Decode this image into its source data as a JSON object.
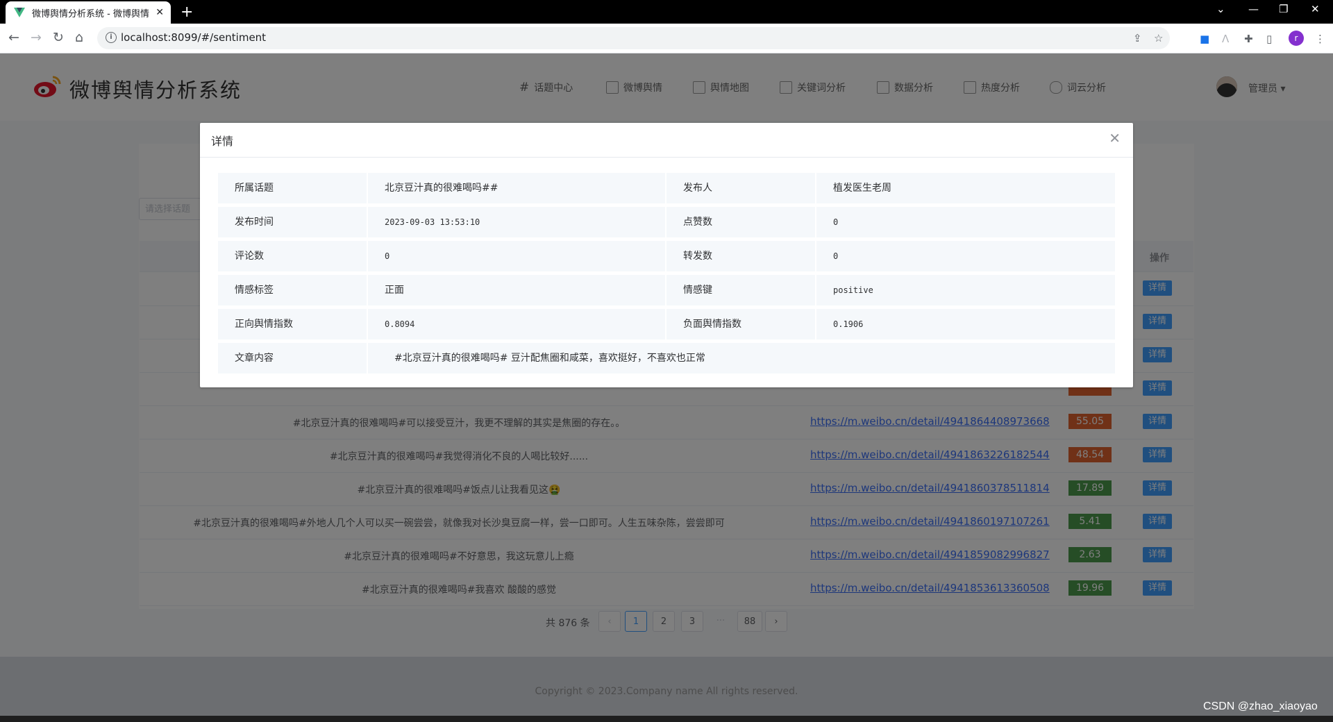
{
  "browser": {
    "tab_title": "微博舆情分析系统 - 微博舆情",
    "tab_close": "✕",
    "new_tab": "+",
    "url": "localhost:8099/#/sentiment",
    "profile_initial": "r"
  },
  "header": {
    "brand": "微博舆情分析系统",
    "nav": [
      "话题中心",
      "微博舆情",
      "舆情地图",
      "关键词分析",
      "数据分析",
      "热度分析",
      "词云分析"
    ],
    "user": "管理员 ▾"
  },
  "search": {
    "placeholder": "请选择话题"
  },
  "table": {
    "op_header": "操作",
    "detail_label": "详情",
    "rows": [
      {
        "content": "#北京豆汁真的很难喝吗#可以接受豆汁，我更不理解的其实是焦圈的存在。。",
        "link": "https://m.weibo.cn/detail/4941864408973668",
        "score": "55.05",
        "color": "#e0632f"
      },
      {
        "content": "#北京豆汁真的很难喝吗#我觉得消化不良的人喝比较好......",
        "link": "https://m.weibo.cn/detail/4941863226182544",
        "score": "48.54",
        "color": "#e0632f"
      },
      {
        "content": "#北京豆汁真的很难喝吗#饭点儿让我看见这🤮",
        "link": "https://m.weibo.cn/detail/4941860378511814",
        "score": "17.89",
        "color": "#4c9a4c"
      },
      {
        "content": "#北京豆汁真的很难喝吗#外地人几个人可以买一碗尝尝，就像我对长沙臭豆腐一样，尝一口即可。人生五味杂陈，尝尝即可",
        "link": "https://m.weibo.cn/detail/4941860197107261",
        "score": "5.41",
        "color": "#4c9a4c"
      },
      {
        "content": "#北京豆汁真的很难喝吗#不好意思，我这玩意儿上瘾",
        "link": "https://m.weibo.cn/detail/4941859082996827",
        "score": "2.63",
        "color": "#4c9a4c"
      },
      {
        "content": "#北京豆汁真的很难喝吗#我喜欢 酸酸的感觉",
        "link": "https://m.weibo.cn/detail/4941853613360508",
        "score": "19.96",
        "color": "#4c9a4c"
      }
    ]
  },
  "pagination": {
    "total": "共 876 条",
    "prev": "‹",
    "pages": [
      "1",
      "2",
      "3"
    ],
    "ellipsis": "···",
    "last": "88",
    "next": "›"
  },
  "footer": {
    "copyright": "Copyright © 2023.Company name All rights reserved."
  },
  "dialog": {
    "title": "详情",
    "close": "✕",
    "fields": [
      {
        "l1": "所属话题",
        "v1": "北京豆汁真的很难喝吗##",
        "l2": "发布人",
        "v2": "植发医生老周"
      },
      {
        "l1": "发布时间",
        "v1": "2023-09-03 13:53:10",
        "l2": "点赞数",
        "v2": "0"
      },
      {
        "l1": "评论数",
        "v1": "0",
        "l2": "转发数",
        "v2": "0"
      },
      {
        "l1": "情感标签",
        "v1": "正面",
        "l2": "情感键",
        "v2": "positive"
      },
      {
        "l1": "正向舆情指数",
        "v1": "0.8094",
        "l2": "负面舆情指数",
        "v2": "0.1906"
      }
    ],
    "content_label": "文章内容",
    "content_value": "#北京豆汁真的很难喝吗# 豆汁配焦圈和咸菜，喜欢挺好，不喜欢也正常"
  },
  "watermark": "CSDN @zhao_xiaoyao"
}
